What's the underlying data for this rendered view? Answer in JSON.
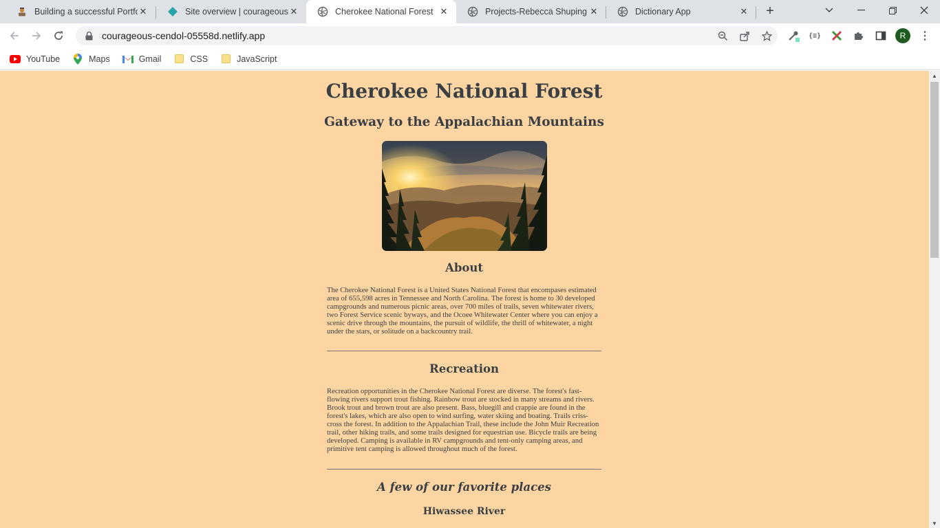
{
  "browser": {
    "tabs": [
      {
        "title": "Building a successful Portfolio",
        "icon": "portfolio-icon"
      },
      {
        "title": "Site overview | courageous-cendol",
        "icon": "netlify-diamond-icon"
      },
      {
        "title": "Cherokee National Forest",
        "icon": "globe-icon",
        "active": true
      },
      {
        "title": "Projects-Rebecca Shuping",
        "icon": "globe-icon"
      },
      {
        "title": "Dictionary App",
        "icon": "globe-icon"
      }
    ],
    "url": "courageous-cendol-05558d.netlify.app",
    "avatar_letter": "R",
    "bookmarks": [
      {
        "label": "YouTube",
        "icon": "youtube-icon"
      },
      {
        "label": "Maps",
        "icon": "maps-pin-icon"
      },
      {
        "label": "Gmail",
        "icon": "gmail-icon"
      },
      {
        "label": "CSS",
        "icon": "folder-icon"
      },
      {
        "label": "JavaScript",
        "icon": "folder-icon"
      }
    ]
  },
  "page": {
    "title": "Cherokee National Forest",
    "subtitle": "Gateway to the Appalachian Mountains",
    "about": {
      "heading": "About",
      "text": "The Cherokee National Forest is a United States National Forest that encompases estimated area of 655,598 acres in Tennessee and North Carolina. The forest is home to 30 developed campgrounds and numerous picnic areas, over 700 miles of trails, seven whitewater rivers, two Forest Service scenic byways, and the Ocoee Whitewater Center where you can enjoy a scenic drive through the mountains, the pursuit of wildlife, the thrill of whitewater, a night under the stars, or solitude on a backcountry trail."
    },
    "recreation": {
      "heading": "Recreation",
      "text": "Recreation opportunities in the Cherokee National Forest are diverse. The forest's fast-flowing rivers support trout fishing. Rainbow trout are stocked in many streams and rivers. Brook trout and brown trout are also present. Bass, bluegill and crappie are found in the forest's lakes, which are also open to wind surfing, water skiing and boating. Trails criss-cross the forest. In addition to the Appalachian Trail, these include the John Muir Recreation trail, other hiking trails, and some trails designed for equestrian use. Bicycle trails are being developed. Camping is available in RV campgrounds and tent-only camping areas, and primitive tent camping is allowed throughout much of the forest."
    },
    "favorites_heading": "A few of our favorite places",
    "first_place": "Hiwassee River"
  },
  "colors": {
    "page_background": "#fdd5a2",
    "text": "#3a3f44"
  }
}
